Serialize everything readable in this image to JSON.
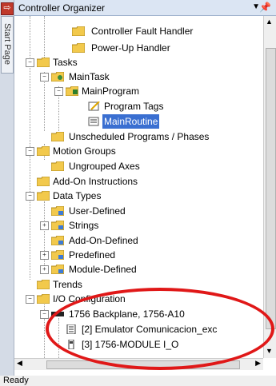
{
  "app": {
    "window_title": "Controller Organizer",
    "start_page_tab": "Start Page",
    "status_text": "Ready"
  },
  "tree": {
    "controller_fault_handler": "Controller Fault Handler",
    "power_up_handler": "Power-Up Handler",
    "tasks": "Tasks",
    "main_task": "MainTask",
    "main_program": "MainProgram",
    "program_tags": "Program Tags",
    "main_routine": "MainRoutine",
    "unscheduled": "Unscheduled Programs / Phases",
    "motion_groups": "Motion Groups",
    "ungrouped_axes": "Ungrouped Axes",
    "add_on_instructions": "Add-On Instructions",
    "data_types": "Data Types",
    "user_defined": "User-Defined",
    "strings": "Strings",
    "add_on_defined": "Add-On-Defined",
    "predefined": "Predefined",
    "module_defined": "Module-Defined",
    "trends": "Trends",
    "io_configuration": "I/O Configuration",
    "backplane": "1756 Backplane, 1756-A10",
    "emulator": "[2] Emulator Comunicacion_exc",
    "module_io": "[3] 1756-MODULE I_O"
  },
  "colors": {
    "selection": "#3a6fd1",
    "highlight_oval": "#e01818",
    "folder": "#f2c94c"
  }
}
